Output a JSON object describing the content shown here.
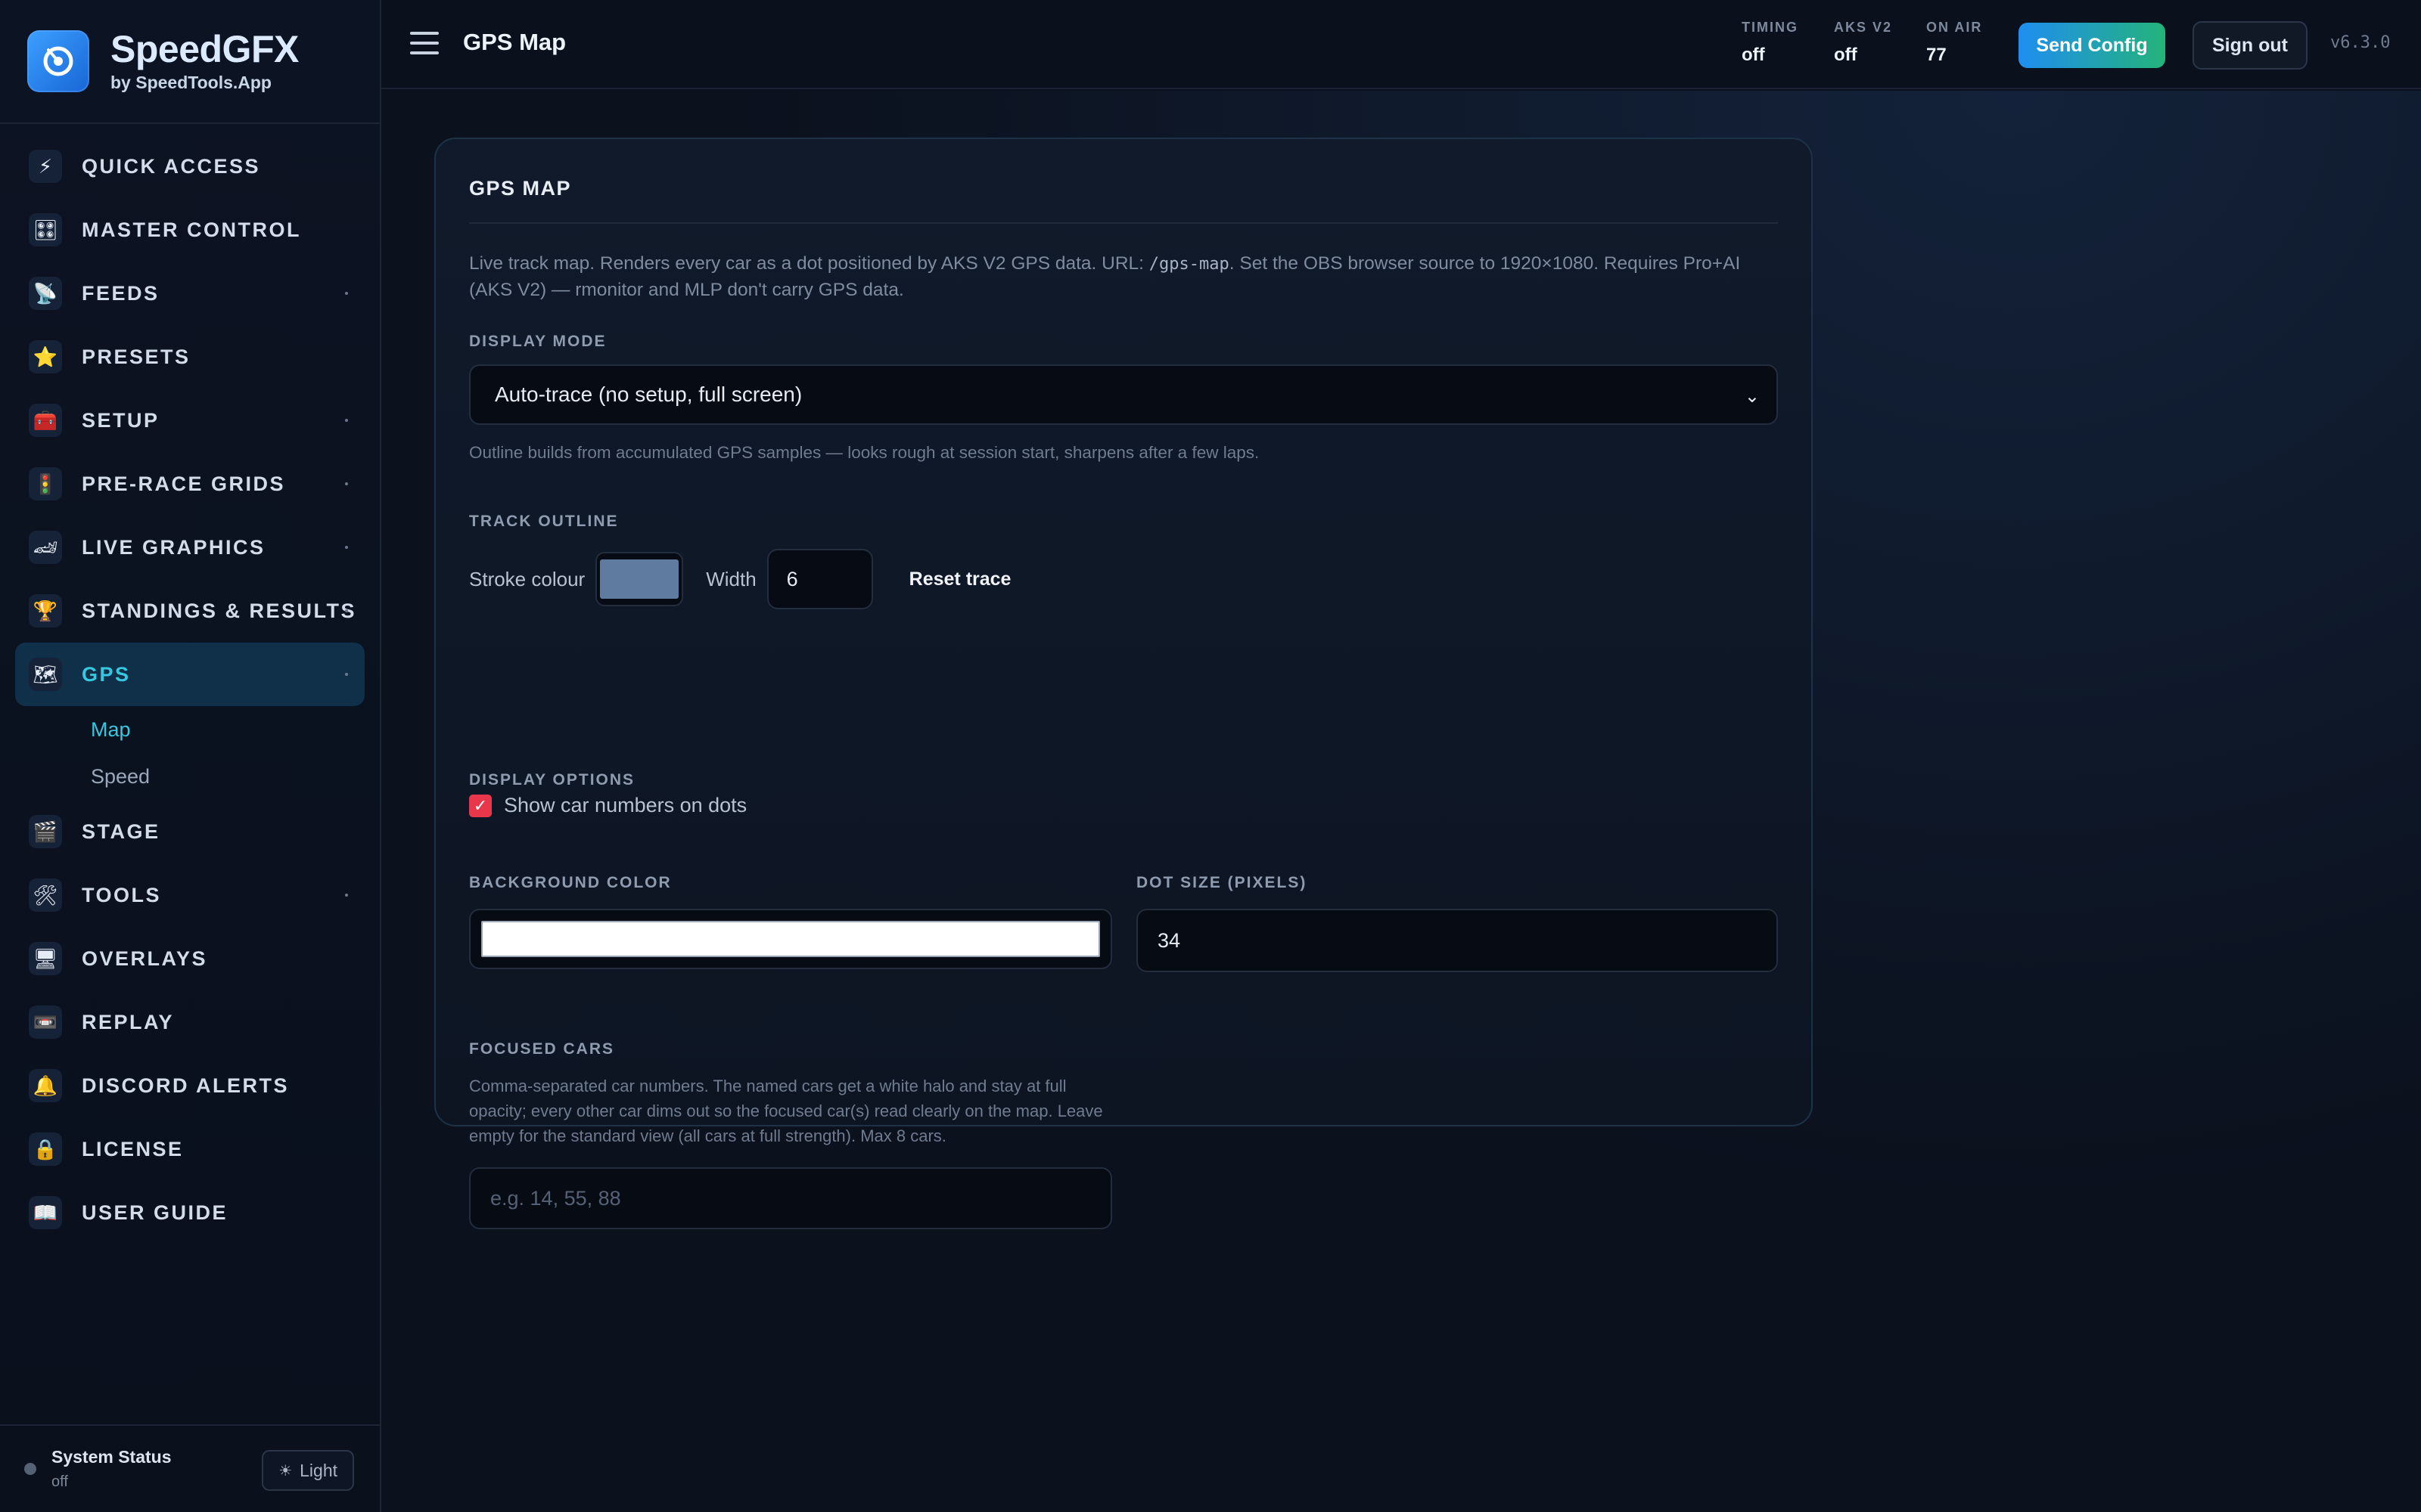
{
  "brand": {
    "title": "SpeedGFX",
    "subtitle": "by SpeedTools.App"
  },
  "sidebar": {
    "items": [
      {
        "label": "QUICK ACCESS",
        "icon": "⚡",
        "expandable": false
      },
      {
        "label": "MASTER CONTROL",
        "icon": "🎛",
        "expandable": false
      },
      {
        "label": "FEEDS",
        "icon": "📡",
        "expandable": true
      },
      {
        "label": "PRESETS",
        "icon": "⭐",
        "expandable": false
      },
      {
        "label": "SETUP",
        "icon": "🧰",
        "expandable": true
      },
      {
        "label": "PRE-RACE GRIDS",
        "icon": "🚦",
        "expandable": true
      },
      {
        "label": "LIVE GRAPHICS",
        "icon": "🏎",
        "expandable": true
      },
      {
        "label": "STANDINGS & RESULTS",
        "icon": "🏆",
        "expandable": true
      },
      {
        "label": "GPS",
        "icon": "🗺",
        "expandable": true,
        "active": true
      },
      {
        "label": "STAGE",
        "icon": "🎬",
        "expandable": false
      },
      {
        "label": "TOOLS",
        "icon": "🛠",
        "expandable": true
      },
      {
        "label": "OVERLAYS",
        "icon": "🖥",
        "expandable": false
      },
      {
        "label": "REPLAY",
        "icon": "📼",
        "expandable": false
      },
      {
        "label": "DISCORD ALERTS",
        "icon": "🔔",
        "expandable": false
      },
      {
        "label": "LICENSE",
        "icon": "🔒",
        "expandable": false
      },
      {
        "label": "USER GUIDE",
        "icon": "📖",
        "expandable": false
      }
    ],
    "gps_sub": [
      {
        "label": "Map",
        "active": true
      },
      {
        "label": "Speed",
        "active": false
      }
    ],
    "footer": {
      "status_title": "System Status",
      "status_value": "off",
      "theme_label": "Light"
    }
  },
  "topbar": {
    "title": "GPS Map",
    "stats": [
      {
        "label": "TIMING",
        "value": "off"
      },
      {
        "label": "AKS V2",
        "value": "off"
      },
      {
        "label": "ON AIR",
        "value": "77"
      }
    ],
    "send_label": "Send Config",
    "signout_label": "Sign out",
    "version": "v6.3.0"
  },
  "card": {
    "title": "GPS MAP",
    "desc_before": "Live track map. Renders every car as a dot positioned by AKS V2 GPS data. URL: ",
    "desc_code": "/gps-map",
    "desc_after": ". Set the OBS browser source to 1920×1080. Requires Pro+AI (AKS V2) — rmonitor and MLP don't carry GPS data.",
    "display_mode_label": "DISPLAY MODE",
    "display_mode_value": "Auto-trace (no setup, full screen)",
    "display_mode_hint": "Outline builds from accumulated GPS samples — looks rough at session start, sharpens after a few laps.",
    "track_outline_label": "TRACK OUTLINE",
    "stroke_colour_label": "Stroke colour",
    "stroke_colour": "#5f7ca0",
    "width_label": "Width",
    "width_value": "6",
    "reset_label": "Reset trace",
    "display_options_label": "DISPLAY OPTIONS",
    "show_numbers_label": "Show car numbers on dots",
    "show_numbers_checked": true,
    "bg_color_label": "BACKGROUND COLOR",
    "bg_color": "#ffffff",
    "dot_size_label": "DOT SIZE (PIXELS)",
    "dot_size_value": "34",
    "focused_label": "FOCUSED CARS",
    "focused_hint": "Comma-separated car numbers. The named cars get a white halo and stay at full opacity; every other car dims out so the focused car(s) read clearly on the map. Leave empty for the standard view (all cars at full strength). Max 8 cars.",
    "focused_placeholder": "e.g. 14, 55, 88"
  },
  "colors": {
    "accent": "#36c8e0",
    "danger": "#e8374a",
    "send_from": "#1f8ef0",
    "send_to": "#24b37a"
  }
}
